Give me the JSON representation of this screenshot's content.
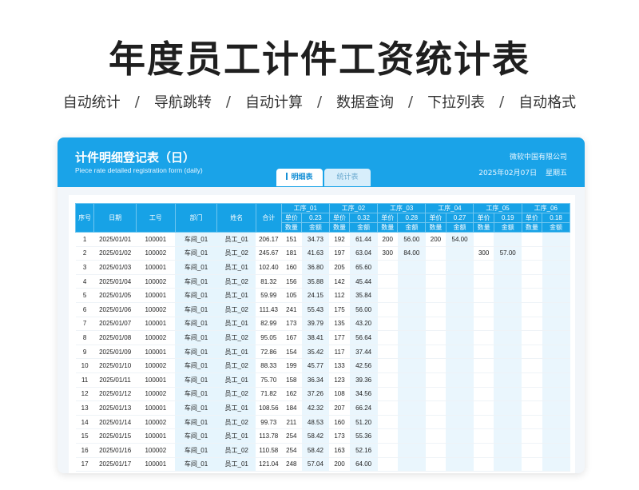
{
  "hero": {
    "title": "年度员工计件工资统计表",
    "features": [
      "自动统计",
      "导航跳转",
      "自动计算",
      "数据查询",
      "下拉列表",
      "自动格式"
    ],
    "separator": "/"
  },
  "card": {
    "title": "计件明细登记表（日）",
    "subtitle": "Piece rate detailed registration form (daily)",
    "company": "微软中国有限公司",
    "date": "2025年02月07日",
    "weekday": "星期五",
    "tabs": [
      {
        "label": "明细表",
        "active": true
      },
      {
        "label": "统计表",
        "active": false
      }
    ],
    "colors": {
      "header": "#1aa3e8",
      "table_header": "#17a2e6",
      "tint": "#e6f5fd"
    }
  },
  "table": {
    "headers": {
      "seq": "序号",
      "date": "日期",
      "id": "工号",
      "dept": "部门",
      "name": "姓名",
      "total": "合计",
      "price_label": "单价",
      "qty_label": "数量",
      "amount_label": "金额"
    },
    "processes": [
      {
        "name": "工序_01",
        "price": "0.23"
      },
      {
        "name": "工序_02",
        "price": "0.32"
      },
      {
        "name": "工序_03",
        "price": "0.28"
      },
      {
        "name": "工序_04",
        "price": "0.27"
      },
      {
        "name": "工序_05",
        "price": "0.19"
      },
      {
        "name": "工序_06",
        "price": "0.18"
      }
    ],
    "rows": [
      {
        "seq": "1",
        "date": "2025/01/01",
        "id": "100001",
        "dept": "车间_01",
        "name": "员工_01",
        "total": "206.17",
        "p": [
          [
            "151",
            "34.73"
          ],
          [
            "192",
            "61.44"
          ],
          [
            "200",
            "56.00"
          ],
          [
            "200",
            "54.00"
          ],
          [
            "",
            ""
          ],
          [
            "",
            ""
          ]
        ]
      },
      {
        "seq": "2",
        "date": "2025/01/02",
        "id": "100002",
        "dept": "车间_01",
        "name": "员工_02",
        "total": "245.67",
        "p": [
          [
            "181",
            "41.63"
          ],
          [
            "197",
            "63.04"
          ],
          [
            "300",
            "84.00"
          ],
          [
            "",
            ""
          ],
          [
            "300",
            "57.00"
          ],
          [
            "",
            ""
          ]
        ]
      },
      {
        "seq": "3",
        "date": "2025/01/03",
        "id": "100001",
        "dept": "车间_01",
        "name": "员工_01",
        "total": "102.40",
        "p": [
          [
            "160",
            "36.80"
          ],
          [
            "205",
            "65.60"
          ],
          [
            "",
            ""
          ],
          [
            "",
            ""
          ],
          [
            "",
            ""
          ],
          [
            "",
            ""
          ]
        ]
      },
      {
        "seq": "4",
        "date": "2025/01/04",
        "id": "100002",
        "dept": "车间_01",
        "name": "员工_02",
        "total": "81.32",
        "p": [
          [
            "156",
            "35.88"
          ],
          [
            "142",
            "45.44"
          ],
          [
            "",
            ""
          ],
          [
            "",
            ""
          ],
          [
            "",
            ""
          ],
          [
            "",
            ""
          ]
        ]
      },
      {
        "seq": "5",
        "date": "2025/01/05",
        "id": "100001",
        "dept": "车间_01",
        "name": "员工_01",
        "total": "59.99",
        "p": [
          [
            "105",
            "24.15"
          ],
          [
            "112",
            "35.84"
          ],
          [
            "",
            ""
          ],
          [
            "",
            ""
          ],
          [
            "",
            ""
          ],
          [
            "",
            ""
          ]
        ]
      },
      {
        "seq": "6",
        "date": "2025/01/06",
        "id": "100002",
        "dept": "车间_01",
        "name": "员工_02",
        "total": "111.43",
        "p": [
          [
            "241",
            "55.43"
          ],
          [
            "175",
            "56.00"
          ],
          [
            "",
            ""
          ],
          [
            "",
            ""
          ],
          [
            "",
            ""
          ],
          [
            "",
            ""
          ]
        ]
      },
      {
        "seq": "7",
        "date": "2025/01/07",
        "id": "100001",
        "dept": "车间_01",
        "name": "员工_01",
        "total": "82.99",
        "p": [
          [
            "173",
            "39.79"
          ],
          [
            "135",
            "43.20"
          ],
          [
            "",
            ""
          ],
          [
            "",
            ""
          ],
          [
            "",
            ""
          ],
          [
            "",
            ""
          ]
        ]
      },
      {
        "seq": "8",
        "date": "2025/01/08",
        "id": "100002",
        "dept": "车间_01",
        "name": "员工_02",
        "total": "95.05",
        "p": [
          [
            "167",
            "38.41"
          ],
          [
            "177",
            "56.64"
          ],
          [
            "",
            ""
          ],
          [
            "",
            ""
          ],
          [
            "",
            ""
          ],
          [
            "",
            ""
          ]
        ]
      },
      {
        "seq": "9",
        "date": "2025/01/09",
        "id": "100001",
        "dept": "车间_01",
        "name": "员工_01",
        "total": "72.86",
        "p": [
          [
            "154",
            "35.42"
          ],
          [
            "117",
            "37.44"
          ],
          [
            "",
            ""
          ],
          [
            "",
            ""
          ],
          [
            "",
            ""
          ],
          [
            "",
            ""
          ]
        ]
      },
      {
        "seq": "10",
        "date": "2025/01/10",
        "id": "100002",
        "dept": "车间_01",
        "name": "员工_02",
        "total": "88.33",
        "p": [
          [
            "199",
            "45.77"
          ],
          [
            "133",
            "42.56"
          ],
          [
            "",
            ""
          ],
          [
            "",
            ""
          ],
          [
            "",
            ""
          ],
          [
            "",
            ""
          ]
        ]
      },
      {
        "seq": "11",
        "date": "2025/01/11",
        "id": "100001",
        "dept": "车间_01",
        "name": "员工_01",
        "total": "75.70",
        "p": [
          [
            "158",
            "36.34"
          ],
          [
            "123",
            "39.36"
          ],
          [
            "",
            ""
          ],
          [
            "",
            ""
          ],
          [
            "",
            ""
          ],
          [
            "",
            ""
          ]
        ]
      },
      {
        "seq": "12",
        "date": "2025/01/12",
        "id": "100002",
        "dept": "车间_01",
        "name": "员工_02",
        "total": "71.82",
        "p": [
          [
            "162",
            "37.26"
          ],
          [
            "108",
            "34.56"
          ],
          [
            "",
            ""
          ],
          [
            "",
            ""
          ],
          [
            "",
            ""
          ],
          [
            "",
            ""
          ]
        ]
      },
      {
        "seq": "13",
        "date": "2025/01/13",
        "id": "100001",
        "dept": "车间_01",
        "name": "员工_01",
        "total": "108.56",
        "p": [
          [
            "184",
            "42.32"
          ],
          [
            "207",
            "66.24"
          ],
          [
            "",
            ""
          ],
          [
            "",
            ""
          ],
          [
            "",
            ""
          ],
          [
            "",
            ""
          ]
        ]
      },
      {
        "seq": "14",
        "date": "2025/01/14",
        "id": "100002",
        "dept": "车间_01",
        "name": "员工_02",
        "total": "99.73",
        "p": [
          [
            "211",
            "48.53"
          ],
          [
            "160",
            "51.20"
          ],
          [
            "",
            ""
          ],
          [
            "",
            ""
          ],
          [
            "",
            ""
          ],
          [
            "",
            ""
          ]
        ]
      },
      {
        "seq": "15",
        "date": "2025/01/15",
        "id": "100001",
        "dept": "车间_01",
        "name": "员工_01",
        "total": "113.78",
        "p": [
          [
            "254",
            "58.42"
          ],
          [
            "173",
            "55.36"
          ],
          [
            "",
            ""
          ],
          [
            "",
            ""
          ],
          [
            "",
            ""
          ],
          [
            "",
            ""
          ]
        ]
      },
      {
        "seq": "16",
        "date": "2025/01/16",
        "id": "100002",
        "dept": "车间_01",
        "name": "员工_02",
        "total": "110.58",
        "p": [
          [
            "254",
            "58.42"
          ],
          [
            "163",
            "52.16"
          ],
          [
            "",
            ""
          ],
          [
            "",
            ""
          ],
          [
            "",
            ""
          ],
          [
            "",
            ""
          ]
        ]
      },
      {
        "seq": "17",
        "date": "2025/01/17",
        "id": "100001",
        "dept": "车间_01",
        "name": "员工_01",
        "total": "121.04",
        "p": [
          [
            "248",
            "57.04"
          ],
          [
            "200",
            "64.00"
          ],
          [
            "",
            ""
          ],
          [
            "",
            ""
          ],
          [
            "",
            ""
          ],
          [
            "",
            ""
          ]
        ]
      }
    ]
  }
}
